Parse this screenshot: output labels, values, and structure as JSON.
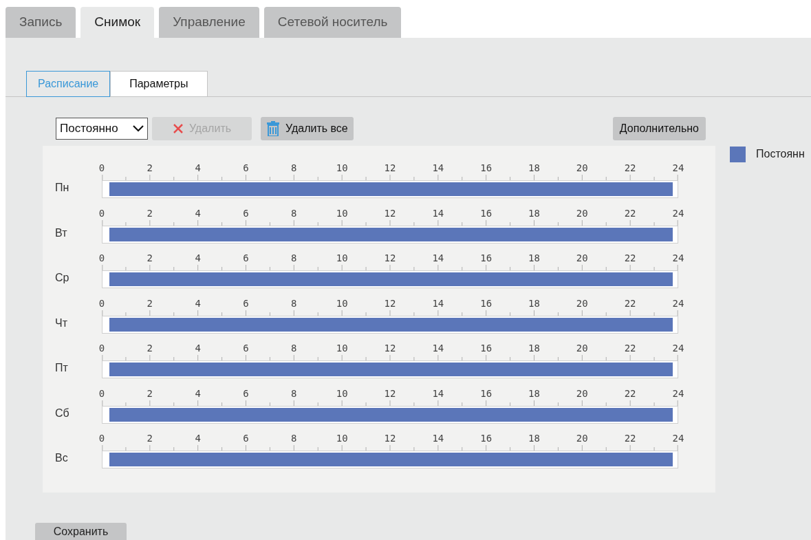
{
  "tabs": [
    {
      "label": "Запись",
      "selected": false
    },
    {
      "label": "Снимок",
      "selected": true
    },
    {
      "label": "Управление",
      "selected": false
    },
    {
      "label": "Сетевой носитель",
      "selected": false
    }
  ],
  "subtabs": [
    {
      "label": "Расписание",
      "selected": true
    },
    {
      "label": "Параметры",
      "selected": false
    }
  ],
  "toolbar": {
    "mode_select": "Постоянно",
    "delete_button": {
      "label": "Удалить",
      "disabled": true
    },
    "delete_all_button": {
      "label": "Удалить все",
      "disabled": false
    },
    "advanced_button": "Дополнительно"
  },
  "legend": [
    {
      "label": "Постоянн",
      "color": "#5b76b9"
    }
  ],
  "days": [
    {
      "label": "Пн",
      "scheduled": true,
      "ticks": [
        "0",
        "2",
        "4",
        "6",
        "8",
        "10",
        "12",
        "14",
        "16",
        "18",
        "20",
        "22",
        "24"
      ]
    },
    {
      "label": "Вт",
      "scheduled": true,
      "ticks": [
        "0",
        "2",
        "4",
        "6",
        "8",
        "10",
        "12",
        "14",
        "16",
        "18",
        "20",
        "22",
        "24"
      ]
    },
    {
      "label": "Ср",
      "scheduled": true,
      "ticks": [
        "0",
        "2",
        "4",
        "6",
        "8",
        "10",
        "12",
        "14",
        "16",
        "18",
        "20",
        "22",
        "24"
      ]
    },
    {
      "label": "Чт",
      "scheduled": true,
      "ticks": [
        "0",
        "2",
        "4",
        "6",
        "8",
        "10",
        "12",
        "14",
        "16",
        "18",
        "20",
        "22",
        "24"
      ]
    },
    {
      "label": "Пт",
      "scheduled": true,
      "ticks": [
        "0",
        "2",
        "4",
        "6",
        "8",
        "10",
        "12",
        "14",
        "16",
        "18",
        "20",
        "22",
        "24"
      ]
    },
    {
      "label": "Сб",
      "scheduled": true,
      "ticks": [
        "0",
        "2",
        "4",
        "6",
        "8",
        "10",
        "12",
        "14",
        "16",
        "18",
        "20",
        "22",
        "24"
      ]
    },
    {
      "label": "Вс",
      "scheduled": true,
      "ticks": [
        "0",
        "2",
        "4",
        "6",
        "8",
        "10",
        "12",
        "14",
        "16",
        "18",
        "20",
        "22",
        "24"
      ]
    }
  ],
  "save_button": "Сохранить"
}
